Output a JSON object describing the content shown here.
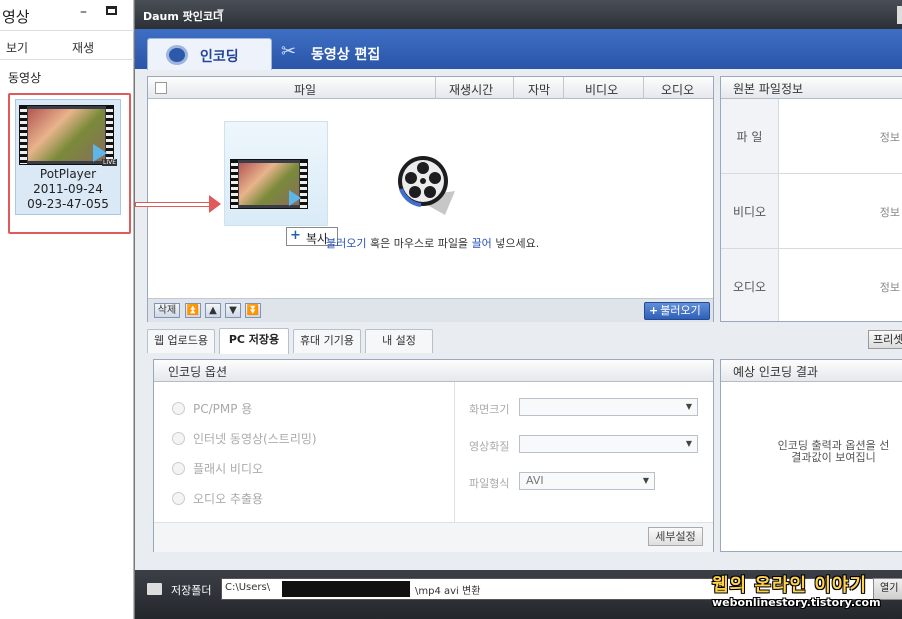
{
  "explorer": {
    "title": "영상",
    "minimize_glyph": "–",
    "menu": [
      "보기",
      "재생"
    ],
    "section_label": "동영상",
    "thumb": {
      "name": "PotPlayer",
      "line2": "2011-09-24",
      "line3": "09-23-47-055",
      "tag": "LIVE"
    }
  },
  "app": {
    "title": "Daum 팟인코더",
    "title_caret": "▼",
    "tabs": [
      {
        "label": "인코딩",
        "active": true
      },
      {
        "label": "동영상 편집",
        "active": false
      }
    ]
  },
  "file_panel": {
    "columns": [
      "파일",
      "재생시간",
      "자막",
      "비디오",
      "오디오"
    ],
    "copy_label": "복사",
    "copy_plus": "+",
    "hint_pre": "",
    "hint_link1": "불러오기",
    "hint_mid": " 혹은 마우스로 파일을 ",
    "hint_link2": "끌어",
    "hint_post": " 넣으세요.",
    "footer_buttons": [
      "삭제",
      "⏫",
      "▲",
      "▼",
      "⏬"
    ],
    "load_plus": "+",
    "load_button": "불러오기"
  },
  "info_panel": {
    "title": "원본 파일정보",
    "rows": [
      {
        "label": "파 일",
        "value": "정보"
      },
      {
        "label": "비디오",
        "value": "정보"
      },
      {
        "label": "오디오",
        "value": "정보"
      }
    ]
  },
  "option_tabs": [
    {
      "label": "웹 업로드용",
      "active": false
    },
    {
      "label": "PC 저장용",
      "active": true
    },
    {
      "label": "휴대 기기용",
      "active": false
    },
    {
      "label": "내 설정",
      "active": false
    }
  ],
  "preset_button": "프리셋",
  "encoding_options": {
    "title": "인코딩 옵션",
    "radios": [
      "PC/PMP 용",
      "인터넷 동영상(스트리밍)",
      "플래시 비디오",
      "오디오 추출용"
    ],
    "fields": [
      {
        "label": "화면크기",
        "value": ""
      },
      {
        "label": "영상화질",
        "value": ""
      },
      {
        "label": "파일형식",
        "value": "AVI"
      }
    ],
    "caret": "▼",
    "detail_button": "세부설정"
  },
  "result_panel": {
    "title": "예상 인코딩 결과",
    "message_line1": "인코딩 출력과 옵션을 선",
    "message_line2": "결과값이 보여집니"
  },
  "bottom_bar": {
    "folder_label": "저장폴더",
    "path_prefix": "C:\\Users\\",
    "path_suffix": "\\mp4 avi 변환",
    "open_button": "열기"
  },
  "watermark": {
    "line1": "웹의 온라인 이야기",
    "line2": "webonlinestory.tistory.com"
  },
  "colors": {
    "accent": "#2b55a8",
    "highlight": "#e05a5a",
    "link": "#2752b8"
  }
}
